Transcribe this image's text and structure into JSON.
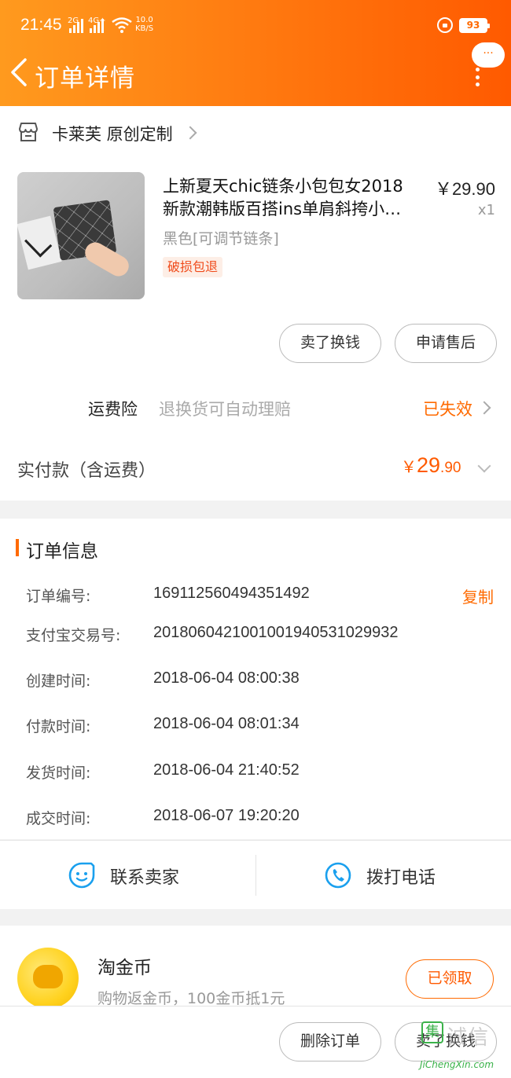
{
  "status_bar": {
    "time": "21:45",
    "net_1": "2G",
    "net_2": "4G+",
    "speed_value": "10.0",
    "speed_unit": "KB/S",
    "battery": "93"
  },
  "header": {
    "title": "订单详情",
    "more_bubble": "···"
  },
  "shop": {
    "name": "卡莱芙 原创定制"
  },
  "product": {
    "title_line1": "上新夏天chic链条小包包女2018",
    "title_line2": "新款潮韩版百搭ins单肩斜挎小…",
    "price": "￥29.90",
    "quantity": "x1",
    "spec": "黑色[可调节链条]",
    "tag": "破损包退"
  },
  "actions": {
    "sell_label": "卖了换钱",
    "after_sale_label": "申请售后"
  },
  "insurance": {
    "label": "运费险",
    "desc": "退换货可自动理赔",
    "status": "已失效"
  },
  "payment": {
    "label": "实付款（含运费）",
    "currency": "￥",
    "amount_int": "29",
    "amount_dec": ".90"
  },
  "order_info": {
    "title": "订单信息",
    "copy_label": "复制",
    "rows": [
      {
        "key": "订单编号:",
        "value": "169112560494351492"
      },
      {
        "key": "支付宝交易号:",
        "value": "2018060421001001940531029932"
      },
      {
        "key": "创建时间:",
        "value": "2018-06-04 08:00:38"
      },
      {
        "key": "付款时间:",
        "value": "2018-06-04 08:01:34"
      },
      {
        "key": "发货时间:",
        "value": "2018-06-04 21:40:52"
      },
      {
        "key": "成交时间:",
        "value": "2018-06-07 19:20:20"
      }
    ]
  },
  "contact": {
    "seller_label": "联系卖家",
    "phone_label": "拨打电话"
  },
  "coins": {
    "title": "淘金币",
    "desc": "购物返金币，100金币抵1元",
    "button_label": "已领取"
  },
  "bottom_bar": {
    "delete_label": "删除订单",
    "sell_label": "卖了换钱"
  },
  "watermark": {
    "logo_char": "集",
    "chinese": "诚信",
    "english": "JiChengXin.com"
  },
  "colors": {
    "accent": "#ff6a00",
    "header_start": "#ff9a1e",
    "header_end": "#ff5a00",
    "tag_bg": "#fdeee6",
    "contact_icon": "#1aa0ee",
    "watermark_green": "#3bb24a"
  }
}
